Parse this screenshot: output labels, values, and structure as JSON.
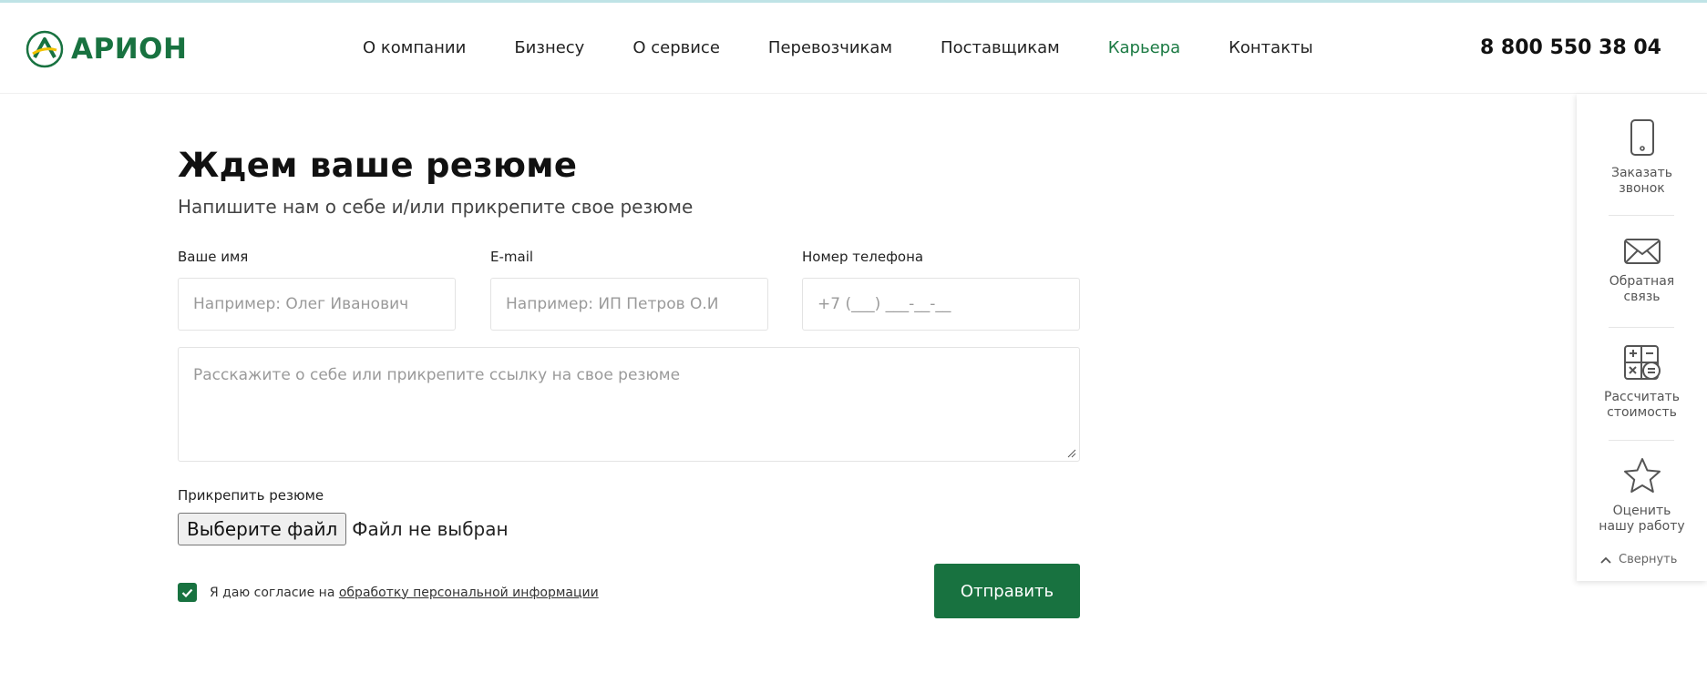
{
  "header": {
    "logo_text": "АРИОН",
    "nav": [
      {
        "label": "О компании",
        "active": false
      },
      {
        "label": "Бизнесу",
        "active": false
      },
      {
        "label": "О сервисе",
        "active": false
      },
      {
        "label": "Перевозчикам",
        "active": false
      },
      {
        "label": "Поставщикам",
        "active": false
      },
      {
        "label": "Карьера",
        "active": true
      },
      {
        "label": "Контакты",
        "active": false
      }
    ],
    "phone": "8 800 550 38 04"
  },
  "form": {
    "title": "Ждем ваше резюме",
    "subtitle": "Напишите нам о себе и/или прикрепите свое резюме",
    "name_label": "Ваше имя",
    "name_placeholder": "Например: Олег Иванович",
    "email_label": "E-mail",
    "email_placeholder": "Например: ИП Петров О.И",
    "phone_label": "Номер телефона",
    "phone_placeholder": "+7 (___) ___-__-__",
    "message_placeholder": "Расскажите о себе или прикрепите ссылку на свое резюме",
    "attach_label": "Прикрепить резюме",
    "file_button": "Выберите файл",
    "file_status": "Файл не выбран",
    "consent_prefix": "Я даю согласие на ",
    "consent_link": "обработку персональной информации",
    "consent_checked": true,
    "submit_label": "Отправить"
  },
  "sidepanel": {
    "items": [
      {
        "icon": "phone-icon",
        "label_line1": "Заказать",
        "label_line2": "звонок"
      },
      {
        "icon": "envelope-icon",
        "label_line1": "Обратная",
        "label_line2": "связь"
      },
      {
        "icon": "calculator-icon",
        "label_line1": "Рассчитать",
        "label_line2": "стоимость"
      },
      {
        "icon": "star-icon",
        "label_line1": "Оценить",
        "label_line2": "нашу работу"
      }
    ],
    "collapse_label": "Свернуть"
  },
  "colors": {
    "brand_green": "#187240",
    "nav_active": "#1b7a43"
  }
}
